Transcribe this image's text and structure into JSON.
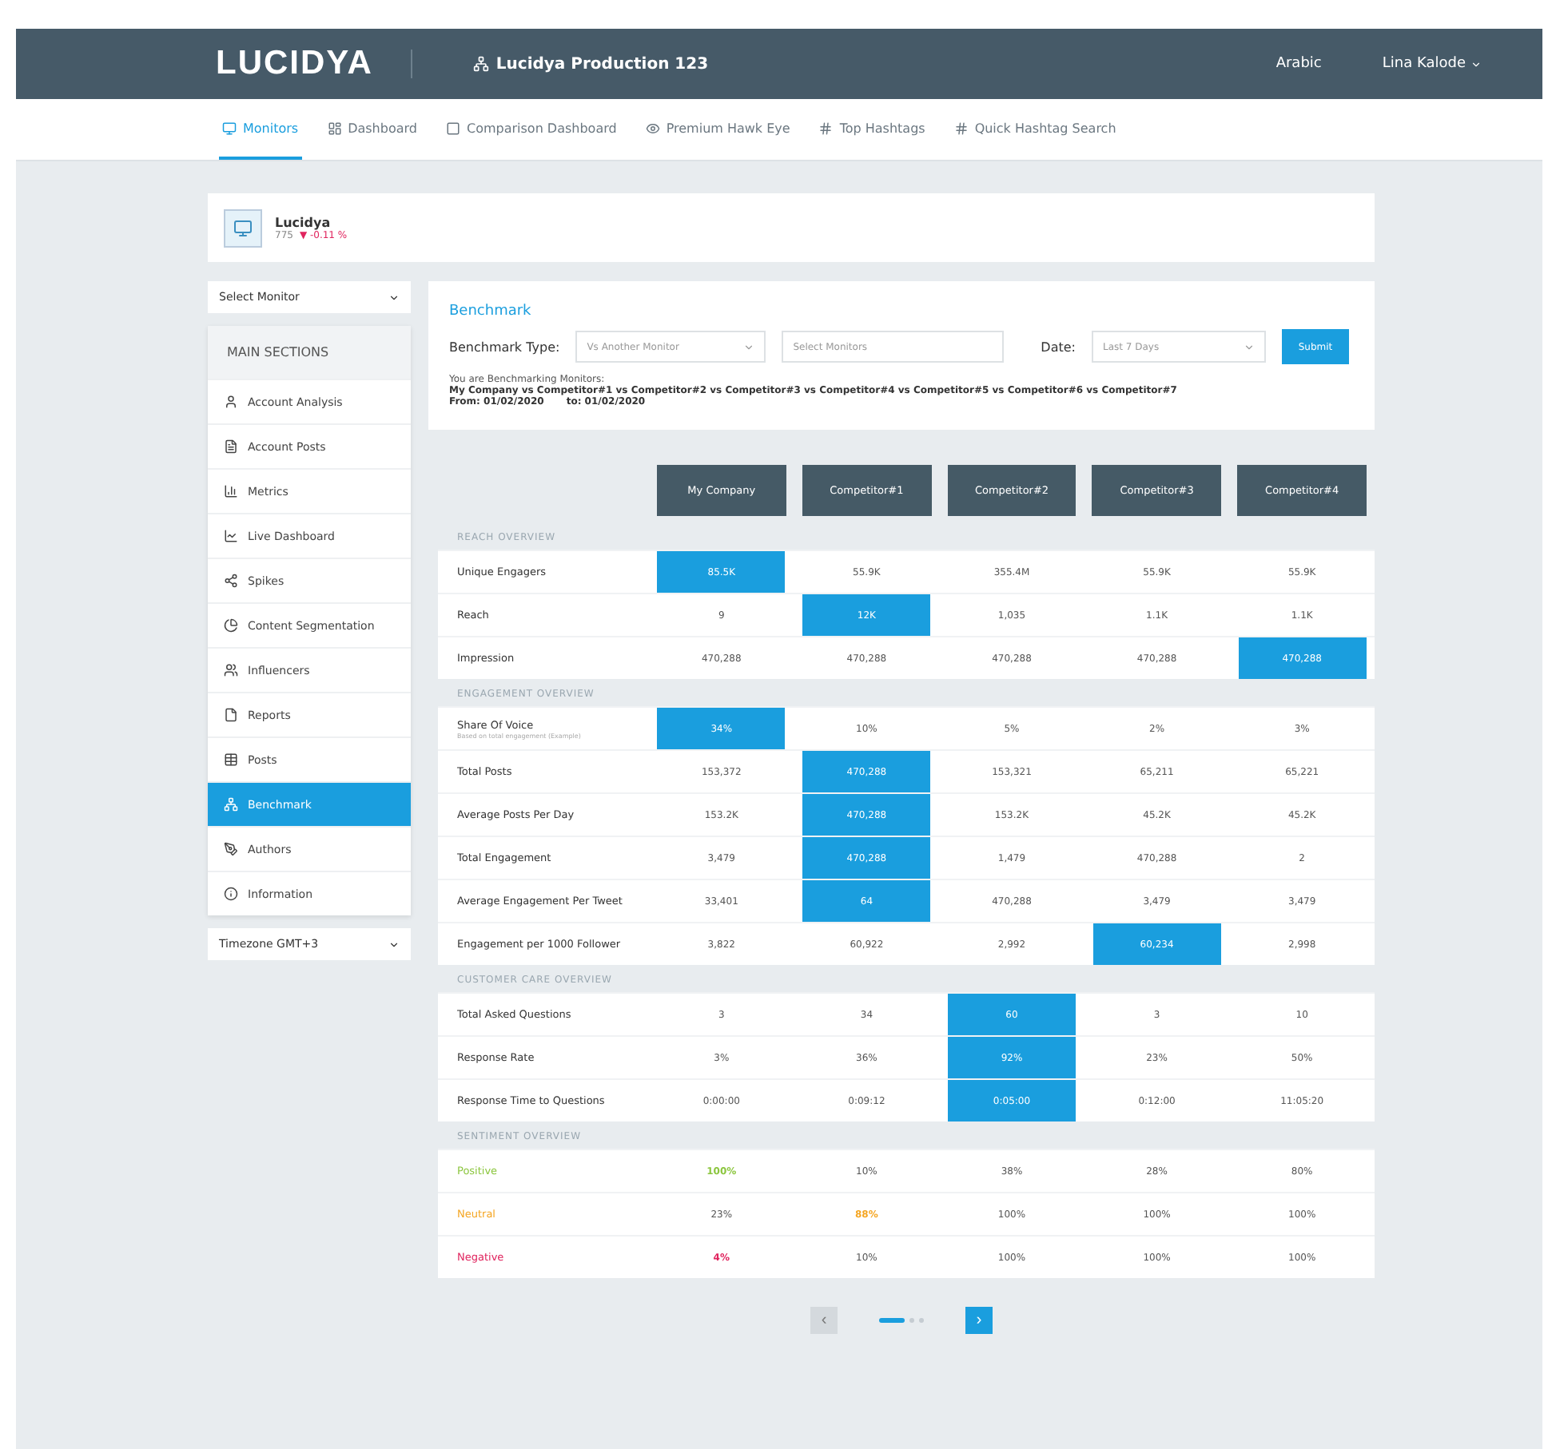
{
  "header": {
    "logo": "LUCIDYA",
    "project": "Lucidya Production 123",
    "language": "Arabic",
    "user": "Lina Kalode"
  },
  "tabs": [
    {
      "label": "Monitors",
      "selected": true
    },
    {
      "label": "Dashboard",
      "selected": false
    },
    {
      "label": "Comparison Dashboard",
      "selected": false
    },
    {
      "label": "Premium Hawk Eye",
      "selected": false
    },
    {
      "label": "Top Hashtags",
      "selected": false
    },
    {
      "label": "Quick Hashtag Search",
      "selected": false
    }
  ],
  "profile": {
    "name": "Lucidya",
    "count": "775",
    "change": "▼ -0.11 %"
  },
  "sidebar": {
    "monitor_select": "Select Monitor",
    "heading": "MAIN SECTIONS",
    "items": [
      {
        "label": "Account Analysis",
        "selected": false
      },
      {
        "label": "Account Posts",
        "selected": false
      },
      {
        "label": "Metrics",
        "selected": false
      },
      {
        "label": "Live Dashboard",
        "selected": false
      },
      {
        "label": "Spikes",
        "selected": false
      },
      {
        "label": "Content Segmentation",
        "selected": false
      },
      {
        "label": "Influencers",
        "selected": false
      },
      {
        "label": "Reports",
        "selected": false
      },
      {
        "label": "Posts",
        "selected": false
      },
      {
        "label": "Benchmark",
        "selected": true
      },
      {
        "label": "Authors",
        "selected": false
      },
      {
        "label": "Information",
        "selected": false
      }
    ],
    "timezone": "Timezone GMT+3"
  },
  "benchmark": {
    "title": "Benchmark",
    "type_label": "Benchmark Type:",
    "type_value": "Vs Another Monitor",
    "monitors_placeholder": "Select Monitors",
    "date_label": "Date:",
    "date_value": "Last 7 Days",
    "submit": "Submit",
    "note": "You are Benchmarking Monitors:",
    "monitors": "My Company vs Competitor#1 vs Competitor#2 vs Competitor#3  vs  Competitor#4  vs Competitor#5 vs Competitor#6  vs Competitor#7",
    "from": "From: 01/02/2020",
    "to": "to: 01/02/2020"
  },
  "columns": [
    "My Company",
    "Competitor#1",
    "Competitor#2",
    "Competitor#3",
    "Competitor#4"
  ],
  "sections": [
    {
      "title": "REACH OVERVIEW",
      "rows": [
        {
          "label": "Unique Engagers",
          "cells": [
            {
              "text": "85.5K",
              "best": true
            },
            {
              "text": "55.9K",
              "best": false
            },
            {
              "text": "355.4M",
              "best": false
            },
            {
              "text": "55.9K",
              "best": false
            },
            {
              "text": "55.9K",
              "best": false
            }
          ]
        },
        {
          "label": "Reach",
          "cells": [
            {
              "text": "9",
              "best": false
            },
            {
              "text": "12K",
              "best": true
            },
            {
              "text": "1,035",
              "best": false
            },
            {
              "text": "1.1K",
              "best": false
            },
            {
              "text": "1.1K",
              "best": false
            }
          ]
        },
        {
          "label": "Impression",
          "cells": [
            {
              "text": "470,288",
              "best": false
            },
            {
              "text": "470,288",
              "best": false
            },
            {
              "text": "470,288",
              "best": false
            },
            {
              "text": "470,288",
              "best": false
            },
            {
              "text": "470,288",
              "best": true
            }
          ]
        }
      ]
    },
    {
      "title": "ENGAGEMENT OVERVIEW",
      "rows": [
        {
          "label": "Share Of Voice",
          "sublabel": "Based on total engagement (Example)",
          "cells": [
            {
              "text": "34%",
              "best": true
            },
            {
              "text": "10%",
              "best": false
            },
            {
              "text": "5%",
              "best": false
            },
            {
              "text": "2%",
              "best": false
            },
            {
              "text": "3%",
              "best": false
            }
          ]
        },
        {
          "label": "Total Posts",
          "cells": [
            {
              "text": "153,372",
              "best": false
            },
            {
              "text": "470,288",
              "best": true
            },
            {
              "text": "153,321",
              "best": false
            },
            {
              "text": "65,211",
              "best": false
            },
            {
              "text": "65,221",
              "best": false
            }
          ]
        },
        {
          "label": "Average Posts Per Day",
          "cells": [
            {
              "text": "153.2K",
              "best": false
            },
            {
              "text": "470,288",
              "best": true
            },
            {
              "text": "153.2K",
              "best": false
            },
            {
              "text": "45.2K",
              "best": false
            },
            {
              "text": "45.2K",
              "best": false
            }
          ]
        },
        {
          "label": "Total Engagement",
          "cells": [
            {
              "text": "3,479",
              "best": false
            },
            {
              "text": "470,288",
              "best": true
            },
            {
              "text": "1,479",
              "best": false
            },
            {
              "text": "470,288",
              "best": false
            },
            {
              "text": "2",
              "best": false
            }
          ]
        },
        {
          "label": "Average Engagement Per Tweet",
          "cells": [
            {
              "text": "33,401",
              "best": false
            },
            {
              "text": "64",
              "best": true
            },
            {
              "text": "470,288",
              "best": false
            },
            {
              "text": "3,479",
              "best": false
            },
            {
              "text": "3,479",
              "best": false
            }
          ]
        },
        {
          "label": "Engagement per 1000 Follower",
          "cells": [
            {
              "text": "3,822",
              "best": false
            },
            {
              "text": "60,922",
              "best": false
            },
            {
              "text": "2,992",
              "best": false
            },
            {
              "text": "60,234",
              "best": true
            },
            {
              "text": "2,998",
              "best": false
            }
          ]
        }
      ]
    },
    {
      "title": "CUSTOMER CARE OVERVIEW",
      "rows": [
        {
          "label": "Total Asked Questions",
          "cells": [
            {
              "text": "3",
              "best": false
            },
            {
              "text": "34",
              "best": false
            },
            {
              "text": "60",
              "best": true
            },
            {
              "text": "3",
              "best": false
            },
            {
              "text": "10",
              "best": false
            }
          ]
        },
        {
          "label": "Response Rate",
          "cells": [
            {
              "text": "3%",
              "best": false
            },
            {
              "text": "36%",
              "best": false
            },
            {
              "text": "92%",
              "best": true
            },
            {
              "text": "23%",
              "best": false
            },
            {
              "text": "50%",
              "best": false
            }
          ]
        },
        {
          "label": "Response Time to Questions",
          "cells": [
            {
              "text": "0:00:00",
              "best": false
            },
            {
              "text": "0:09:12",
              "best": false
            },
            {
              "text": "0:05:00",
              "best": true
            },
            {
              "text": "0:12:00",
              "best": false
            },
            {
              "text": "11:05:20",
              "best": false
            }
          ]
        }
      ]
    },
    {
      "title": "SENTIMENT OVERVIEW",
      "rows": [
        {
          "label": "Positive",
          "color": "#8cc63f",
          "cells": [
            {
              "text": "100%",
              "tinted": true
            },
            {
              "text": "10%",
              "tinted": false
            },
            {
              "text": "38%",
              "tinted": false
            },
            {
              "text": "28%",
              "tinted": false
            },
            {
              "text": "80%",
              "tinted": false
            }
          ]
        },
        {
          "label": "Neutral",
          "color": "#f5a623",
          "cells": [
            {
              "text": "23%",
              "tinted": false
            },
            {
              "text": "88%",
              "tinted": true
            },
            {
              "text": "100%",
              "tinted": false
            },
            {
              "text": "100%",
              "tinted": false
            },
            {
              "text": "100%",
              "tinted": false
            }
          ]
        },
        {
          "label": "Negative",
          "color": "#e0245e",
          "cells": [
            {
              "text": "4%",
              "tinted": true
            },
            {
              "text": "10%",
              "tinted": false
            },
            {
              "text": "100%",
              "tinted": false
            },
            {
              "text": "100%",
              "tinted": false
            },
            {
              "text": "100%",
              "tinted": false
            }
          ]
        }
      ]
    }
  ],
  "pagination": {
    "prev": "‹",
    "next": "›",
    "pages": [
      {
        "selected": true
      },
      {
        "selected": false
      },
      {
        "selected": false
      }
    ]
  }
}
